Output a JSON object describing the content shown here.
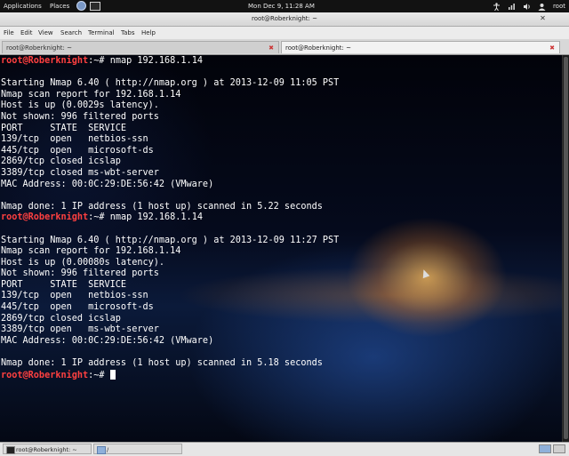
{
  "top_panel": {
    "applications": "Applications",
    "places": "Places",
    "clock": "Mon Dec  9, 11:28 AM",
    "user": "root",
    "launchers": [
      "globe-icon",
      "terminal-icon"
    ],
    "tray_icons": [
      "accessibility-icon",
      "network-icon",
      "volume-icon"
    ]
  },
  "window": {
    "title": "root@Roberknight: ~",
    "menu": [
      "File",
      "Edit",
      "View",
      "Search",
      "Terminal",
      "Tabs",
      "Help"
    ],
    "tabs": [
      {
        "label": "root@Roberknight: ~",
        "active": false
      },
      {
        "label": "root@Roberknight: ~",
        "active": true
      }
    ]
  },
  "terminal": {
    "prompt_user": "root@Roberknight",
    "prompt_path": ":~# ",
    "lines": [
      {
        "type": "prompt",
        "cmd": "nmap 192.168.1.14"
      },
      {
        "type": "text",
        "text": ""
      },
      {
        "type": "text",
        "text": "Starting Nmap 6.40 ( http://nmap.org ) at 2013-12-09 11:05 PST"
      },
      {
        "type": "text",
        "text": "Nmap scan report for 192.168.1.14"
      },
      {
        "type": "text",
        "text": "Host is up (0.0029s latency)."
      },
      {
        "type": "text",
        "text": "Not shown: 996 filtered ports"
      },
      {
        "type": "text",
        "text": "PORT     STATE  SERVICE"
      },
      {
        "type": "text",
        "text": "139/tcp  open   netbios-ssn"
      },
      {
        "type": "text",
        "text": "445/tcp  open   microsoft-ds"
      },
      {
        "type": "text",
        "text": "2869/tcp closed icslap"
      },
      {
        "type": "text",
        "text": "3389/tcp closed ms-wbt-server"
      },
      {
        "type": "text",
        "text": "MAC Address: 00:0C:29:DE:56:42 (VMware)"
      },
      {
        "type": "text",
        "text": ""
      },
      {
        "type": "text",
        "text": "Nmap done: 1 IP address (1 host up) scanned in 5.22 seconds"
      },
      {
        "type": "prompt",
        "cmd": "nmap 192.168.1.14"
      },
      {
        "type": "text",
        "text": ""
      },
      {
        "type": "text",
        "text": "Starting Nmap 6.40 ( http://nmap.org ) at 2013-12-09 11:27 PST"
      },
      {
        "type": "text",
        "text": "Nmap scan report for 192.168.1.14"
      },
      {
        "type": "text",
        "text": "Host is up (0.00080s latency)."
      },
      {
        "type": "text",
        "text": "Not shown: 996 filtered ports"
      },
      {
        "type": "text",
        "text": "PORT     STATE  SERVICE"
      },
      {
        "type": "text",
        "text": "139/tcp  open   netbios-ssn"
      },
      {
        "type": "text",
        "text": "445/tcp  open   microsoft-ds"
      },
      {
        "type": "text",
        "text": "2869/tcp closed icslap"
      },
      {
        "type": "text",
        "text": "3389/tcp open   ms-wbt-server"
      },
      {
        "type": "text",
        "text": "MAC Address: 00:0C:29:DE:56:42 (VMware)"
      },
      {
        "type": "text",
        "text": ""
      },
      {
        "type": "text",
        "text": "Nmap done: 1 IP address (1 host up) scanned in 5.18 seconds"
      },
      {
        "type": "prompt",
        "cmd": "",
        "cursor": true
      }
    ]
  },
  "taskbar": {
    "tasks": [
      {
        "label": "root@Roberknight: ~",
        "icon": "terminal-icon"
      },
      {
        "label": "/",
        "icon": "folder-icon"
      }
    ],
    "workspaces": [
      "workspace-1",
      "workspace-2"
    ]
  },
  "colors": {
    "prompt_user": "#ff4040",
    "terminal_text": "#ffffff",
    "panel": "#121212"
  }
}
